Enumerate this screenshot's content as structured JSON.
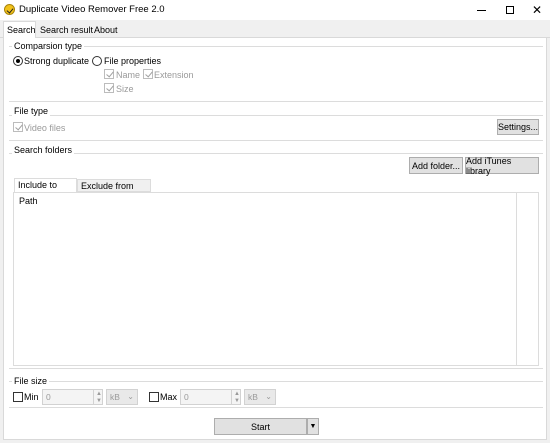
{
  "window": {
    "title": "Duplicate Video Remover Free 2.0",
    "controls": {
      "minimize": "—",
      "maximize": "☐",
      "close": "✕"
    }
  },
  "tabs": [
    {
      "label": "Search",
      "active": true
    },
    {
      "label": "Search result",
      "active": false
    },
    {
      "label": "About",
      "active": false
    }
  ],
  "comparison": {
    "group_label": "Comparsion type",
    "strong_duplicate": "Strong duplicate",
    "file_properties": "File properties",
    "name": "Name",
    "extension": "Extension",
    "size": "Size",
    "selected": "strong_duplicate"
  },
  "file_type": {
    "group_label": "File type",
    "video_files": "Video files",
    "settings_button": "Settings..."
  },
  "search_folders": {
    "group_label": "Search folders",
    "add_folder_button": "Add folder...",
    "add_itunes_button": "Add iTunes library",
    "tabs": [
      "Include to scan",
      "Exclude from scan"
    ],
    "column_header": "Path"
  },
  "file_size": {
    "group_label": "File size",
    "min_label": "Min",
    "min_value": "0",
    "min_unit": "kB",
    "max_label": "Max",
    "max_value": "0",
    "max_unit": "kB"
  },
  "start_button": "Start",
  "icons": {
    "app": "app-logo-icon",
    "dropdown": "chevron-down-icon"
  }
}
